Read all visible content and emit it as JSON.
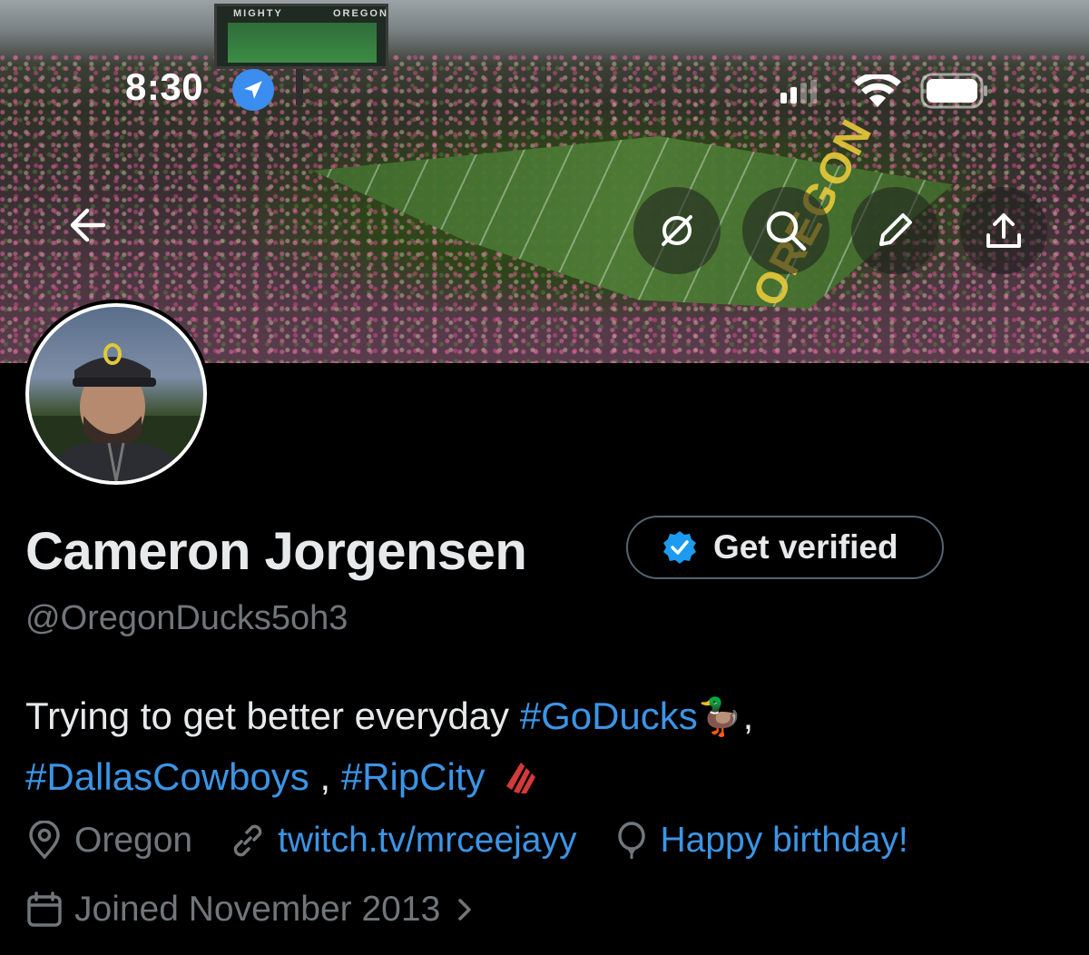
{
  "status_bar": {
    "time": "8:30"
  },
  "banner": {
    "scoreboard_left": "MIGHTY",
    "scoreboard_right": "OREGON",
    "endzone": "OREGON"
  },
  "profile": {
    "display_name": "Cameron Jorgensen",
    "handle": "@OregonDucks5oh3",
    "get_verified_label": "Get verified",
    "bio": {
      "text_1": "Trying to get better everyday ",
      "hashtag_1": "#GoDucks",
      "emoji_1": "🦆",
      "sep_1": ",",
      "hashtag_2": "#DallasCowboys",
      "sep_2": " , ",
      "hashtag_3": "#RipCity"
    },
    "location": "Oregon",
    "website": "twitch.tv/mrceejayy",
    "birthday": "Happy birthday!",
    "joined": "Joined November 2013"
  },
  "colors": {
    "accent": "#3b95e6",
    "muted": "#71767b",
    "verified": "#1d9bf0",
    "location_badge": "#3b8df0"
  },
  "icons": [
    "back-arrow-icon",
    "location-arrow-icon",
    "cellular-signal-icon",
    "wifi-icon",
    "battery-icon",
    "grok-icon",
    "search-icon",
    "edit-pencil-icon",
    "share-icon",
    "verified-badge-icon",
    "location-pin-icon",
    "link-icon",
    "balloon-icon",
    "calendar-icon",
    "chevron-right-icon",
    "rip-city-pinwheel-icon"
  ]
}
